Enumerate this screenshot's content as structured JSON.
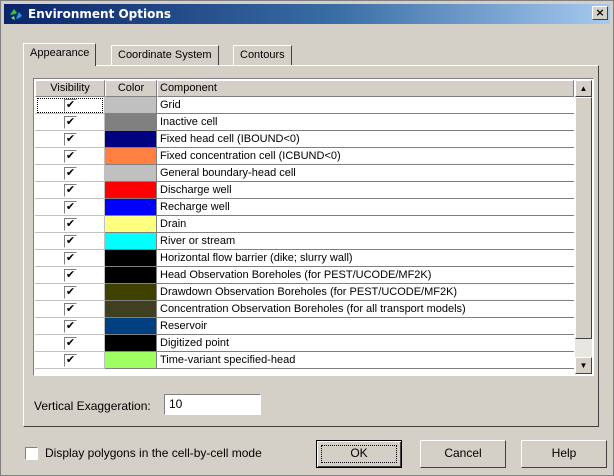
{
  "window": {
    "title": "Environment Options",
    "close_glyph": "×"
  },
  "tabs": [
    {
      "label": "Appearance",
      "active": true
    },
    {
      "label": "Coordinate System",
      "active": false
    },
    {
      "label": "Contours",
      "active": false
    }
  ],
  "grid": {
    "headers": {
      "visibility": "Visibility",
      "color": "Color",
      "component": "Component"
    },
    "check_glyph": "✔",
    "rows": [
      {
        "visible": true,
        "color": "#c0c0c0",
        "component": "Grid"
      },
      {
        "visible": true,
        "color": "#808080",
        "component": "Inactive cell"
      },
      {
        "visible": true,
        "color": "#000080",
        "component": "Fixed head cell (IBOUND<0)"
      },
      {
        "visible": true,
        "color": "#ff8040",
        "component": "Fixed concentration cell (ICBUND<0)"
      },
      {
        "visible": true,
        "color": "#c0c0c0",
        "component": "General boundary-head cell"
      },
      {
        "visible": true,
        "color": "#ff0000",
        "component": "Discharge well"
      },
      {
        "visible": true,
        "color": "#0000ff",
        "component": "Recharge well"
      },
      {
        "visible": true,
        "color": "#ffff80",
        "component": "Drain"
      },
      {
        "visible": true,
        "color": "#00ffff",
        "component": "River or stream"
      },
      {
        "visible": true,
        "color": "#000000",
        "component": "Horizontal flow barrier (dike; slurry wall)"
      },
      {
        "visible": true,
        "color": "#000000",
        "component": "Head Observation Boreholes (for PEST/UCODE/MF2K)"
      },
      {
        "visible": true,
        "color": "#404000",
        "component": "Drawdown Observation Boreholes (for PEST/UCODE/MF2K)"
      },
      {
        "visible": true,
        "color": "#404020",
        "component": "Concentration Observation Boreholes (for all transport models)"
      },
      {
        "visible": true,
        "color": "#004080",
        "component": "Reservoir"
      },
      {
        "visible": true,
        "color": "#000000",
        "component": "Digitized point"
      },
      {
        "visible": true,
        "color": "#a0ff60",
        "component": "Time-variant specified-head"
      }
    ],
    "scroll_up_glyph": "▲",
    "scroll_down_glyph": "▼"
  },
  "vertical_exaggeration": {
    "label": "Vertical Exaggeration:",
    "value": "10"
  },
  "display_polygons": {
    "label": "Display polygons in the cell-by-cell mode",
    "checked": false
  },
  "buttons": {
    "ok": "OK",
    "cancel": "Cancel",
    "help": "Help"
  }
}
